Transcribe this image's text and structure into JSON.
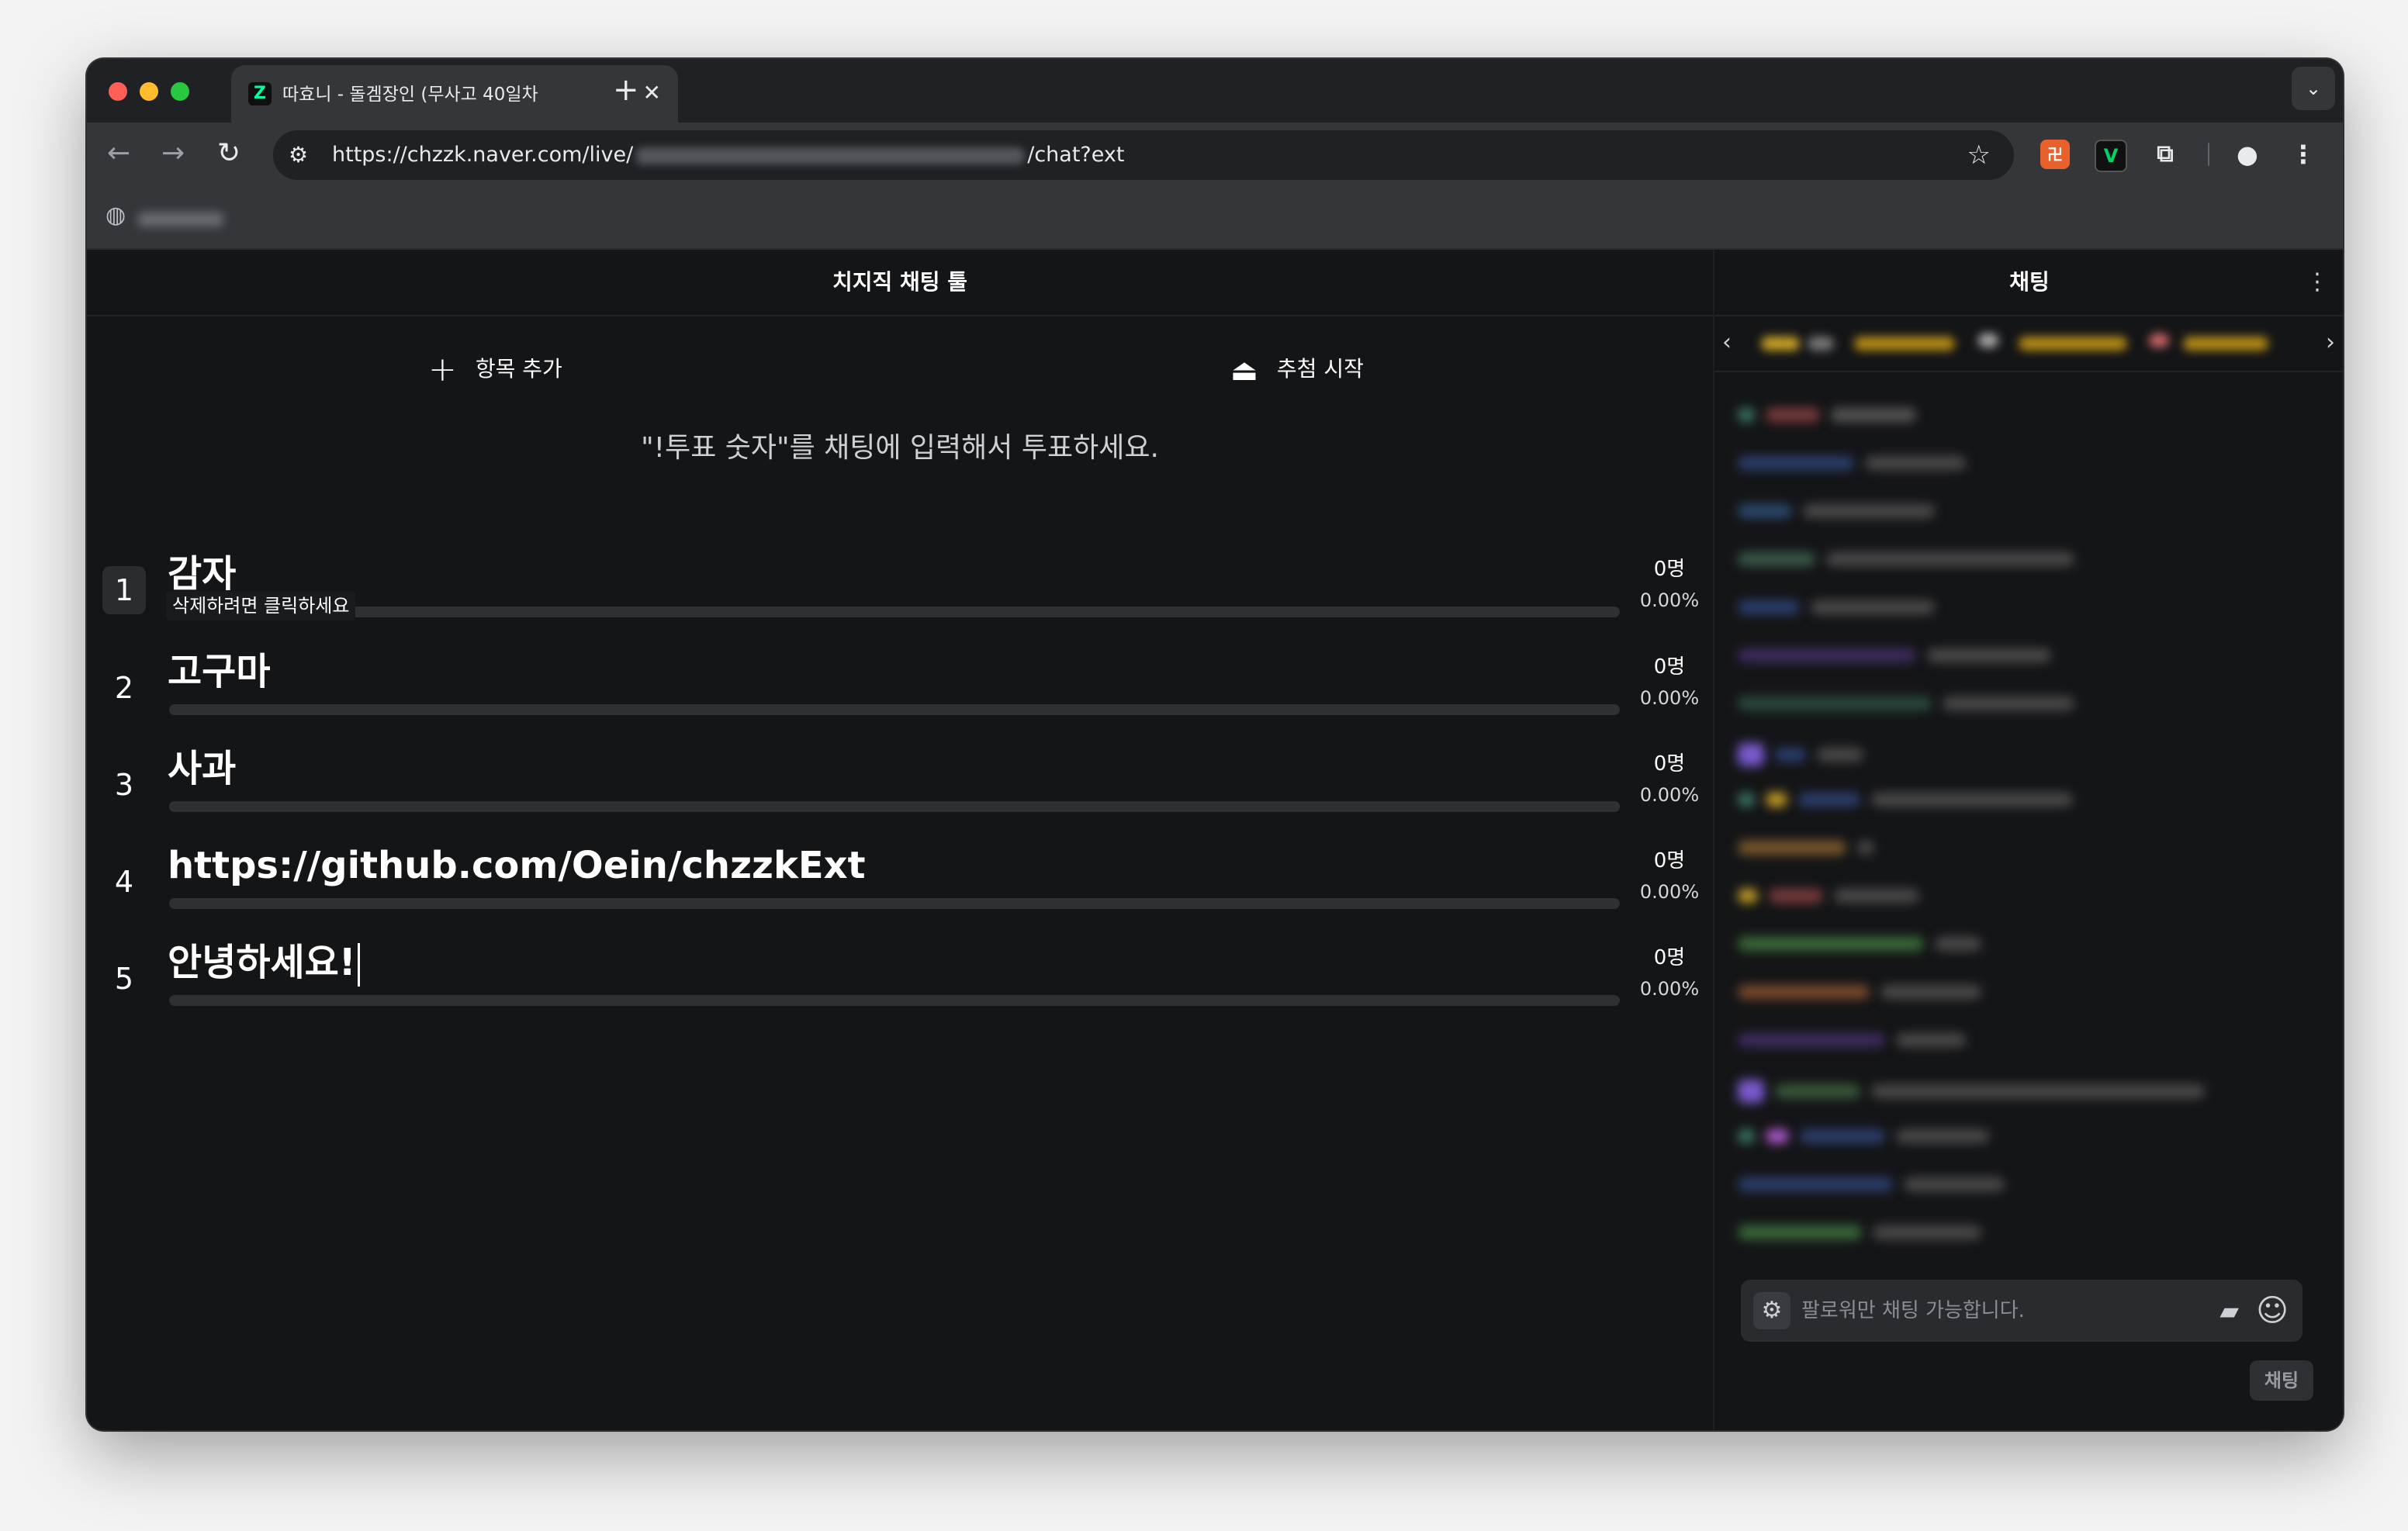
{
  "browser": {
    "tab_title": "따효니 - 돌겜장인 (무사고 40일차",
    "tab_favicon": "chzzk-icon",
    "url_prefix": "https://chzzk.naver.com/live/",
    "url_suffix": "/chat?ext",
    "icons": [
      "back-icon",
      "forward-icon",
      "reload-icon",
      "site-settings-icon",
      "bookmark-star-icon",
      "extension-icon",
      "profile-icon",
      "menu-icon"
    ]
  },
  "left": {
    "title": "치지직 채팅 툴",
    "add_item": "항목 추가",
    "start_draw": "추첨 시작",
    "guide": "\"!투표 숫자\"를 채팅에 입력해서 투표하세요.",
    "tooltip": "삭제하려면 클릭하세요",
    "items": [
      {
        "num": "1",
        "label": "감자",
        "count": "0명",
        "pct": "0.00%"
      },
      {
        "num": "2",
        "label": "고구마",
        "count": "0명",
        "pct": "0.00%"
      },
      {
        "num": "3",
        "label": "사과",
        "count": "0명",
        "pct": "0.00%"
      },
      {
        "num": "4",
        "label": "https://github.com/Oein/chzzkExt",
        "count": "0명",
        "pct": "0.00%"
      },
      {
        "num": "5",
        "label": "안녕하세요!",
        "count": "0명",
        "pct": "0.00%"
      }
    ]
  },
  "right": {
    "title": "채팅",
    "input_placeholder": "팔로워만 채팅 가능합니다.",
    "send_label": "채팅"
  },
  "colors": {
    "background": "#141517",
    "chrome": "#35363a",
    "bar": "#2f3034",
    "accent": "#00ffa3"
  }
}
